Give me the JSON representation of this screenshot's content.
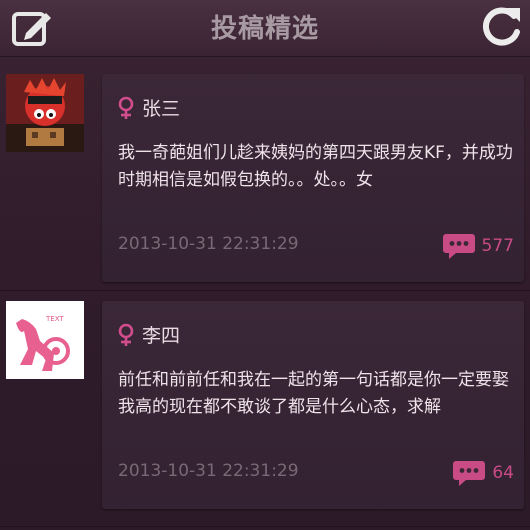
{
  "header": {
    "title": "投稿精选",
    "compose_icon": "compose-icon",
    "refresh_icon": "refresh-icon"
  },
  "posts": [
    {
      "author": "张三",
      "gender_icon": "female-icon",
      "content": "我一奇葩姐们儿趁来姨妈的第四天跟男友KF，并成功时期相信是如假包换的。。处。。女",
      "timestamp": "2013-10-31 22:31:29",
      "comment_icon": "comment-icon",
      "comment_count": "577"
    },
    {
      "author": "李四",
      "gender_icon": "female-icon",
      "content": "前任和前前任和我在一起的第一句话都是你一定要娶我高的现在都不敢谈了都是什么心态，求解",
      "timestamp": "2013-10-31 22:31:29",
      "comment_icon": "comment-icon",
      "comment_count": "64"
    }
  ],
  "colors": {
    "accent": "#c94b86",
    "background": "#301c2b",
    "card": "#3a2737"
  }
}
